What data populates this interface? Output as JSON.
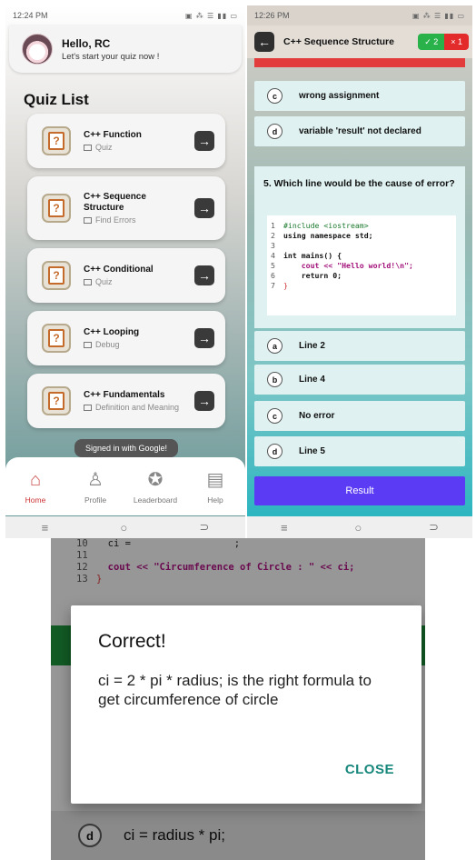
{
  "left_screen": {
    "status": {
      "time": "12:24 PM",
      "icons": "▣ ⁂ ☰ ▮▮ ▭"
    },
    "greeting": {
      "title": "Hello, RC",
      "subtitle": "Let's start your quiz now !"
    },
    "section_title": "Quiz List",
    "quizzes": [
      {
        "title": "C++ Function",
        "type": "Quiz"
      },
      {
        "title": "C++ Sequence Structure",
        "type": "Find Errors"
      },
      {
        "title": "C++ Conditional",
        "type": "Quiz"
      },
      {
        "title": "C++ Looping",
        "type": "Debug"
      },
      {
        "title": "C++ Fundamentals",
        "type": "Definition and Meaning"
      }
    ],
    "toast": "Signed in with Google!",
    "nav": [
      {
        "label": "Home",
        "icon": "home-icon",
        "active": true
      },
      {
        "label": "Profile",
        "icon": "profile-icon",
        "active": false
      },
      {
        "label": "Leaderboard",
        "icon": "leaderboard-icon",
        "active": false
      },
      {
        "label": "Help",
        "icon": "help-icon",
        "active": false
      }
    ]
  },
  "right_screen": {
    "status": {
      "time": "12:26 PM"
    },
    "header": {
      "title": "C++ Sequence Structure",
      "correct": "✓ 2",
      "wrong": "× 1"
    },
    "prev_options": [
      {
        "letter": "c",
        "text": "wrong assignment"
      },
      {
        "letter": "d",
        "text": "variable 'result' not declared"
      }
    ],
    "question": "5. Which line would be the cause of error?",
    "code": [
      {
        "n": "1",
        "text": "#include <iostream>"
      },
      {
        "n": "2",
        "text": "using namespace std;"
      },
      {
        "n": "3",
        "text": ""
      },
      {
        "n": "4",
        "text": "int mains() {"
      },
      {
        "n": "5",
        "text": "    cout << \"Hello world!\\n\";"
      },
      {
        "n": "6",
        "text": "    return 0;"
      },
      {
        "n": "7",
        "text": "}"
      }
    ],
    "options": [
      {
        "letter": "a",
        "text": "Line 2"
      },
      {
        "letter": "b",
        "text": "Line 4"
      },
      {
        "letter": "c",
        "text": "No error"
      },
      {
        "letter": "d",
        "text": "Line 5"
      }
    ],
    "result_button": "Result"
  },
  "bottom_screen": {
    "code_lines": [
      {
        "n": "10",
        "text": "  ci =                  ;"
      },
      {
        "n": "11",
        "text": ""
      },
      {
        "n": "12",
        "text": "  cout << \"Circumference of Circle : \" << ci;"
      },
      {
        "n": "13",
        "text": "}"
      }
    ],
    "dialog": {
      "title": "Correct!",
      "message": "ci = 2 * pi * radius; is the right formula to get circumference of circle",
      "close": "CLOSE"
    },
    "background_option": {
      "letter": "d",
      "text": "ci = radius * pi;"
    }
  }
}
